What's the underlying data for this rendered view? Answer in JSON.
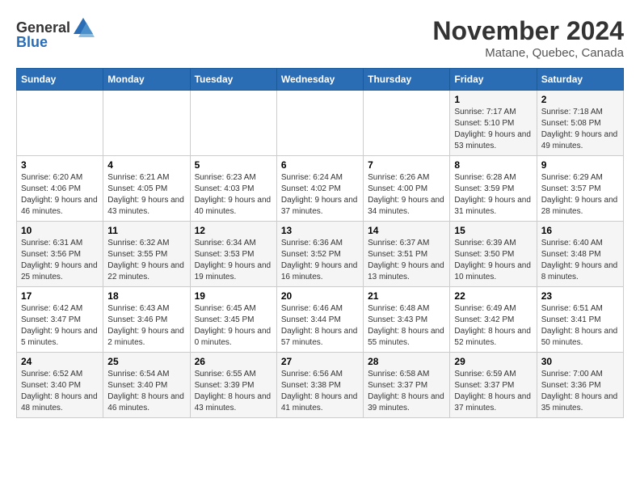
{
  "header": {
    "logo_general": "General",
    "logo_blue": "Blue",
    "month_year": "November 2024",
    "location": "Matane, Quebec, Canada"
  },
  "weekdays": [
    "Sunday",
    "Monday",
    "Tuesday",
    "Wednesday",
    "Thursday",
    "Friday",
    "Saturday"
  ],
  "weeks": [
    [
      {
        "day": "",
        "info": ""
      },
      {
        "day": "",
        "info": ""
      },
      {
        "day": "",
        "info": ""
      },
      {
        "day": "",
        "info": ""
      },
      {
        "day": "",
        "info": ""
      },
      {
        "day": "1",
        "info": "Sunrise: 7:17 AM\nSunset: 5:10 PM\nDaylight: 9 hours and 53 minutes."
      },
      {
        "day": "2",
        "info": "Sunrise: 7:18 AM\nSunset: 5:08 PM\nDaylight: 9 hours and 49 minutes."
      }
    ],
    [
      {
        "day": "3",
        "info": "Sunrise: 6:20 AM\nSunset: 4:06 PM\nDaylight: 9 hours and 46 minutes."
      },
      {
        "day": "4",
        "info": "Sunrise: 6:21 AM\nSunset: 4:05 PM\nDaylight: 9 hours and 43 minutes."
      },
      {
        "day": "5",
        "info": "Sunrise: 6:23 AM\nSunset: 4:03 PM\nDaylight: 9 hours and 40 minutes."
      },
      {
        "day": "6",
        "info": "Sunrise: 6:24 AM\nSunset: 4:02 PM\nDaylight: 9 hours and 37 minutes."
      },
      {
        "day": "7",
        "info": "Sunrise: 6:26 AM\nSunset: 4:00 PM\nDaylight: 9 hours and 34 minutes."
      },
      {
        "day": "8",
        "info": "Sunrise: 6:28 AM\nSunset: 3:59 PM\nDaylight: 9 hours and 31 minutes."
      },
      {
        "day": "9",
        "info": "Sunrise: 6:29 AM\nSunset: 3:57 PM\nDaylight: 9 hours and 28 minutes."
      }
    ],
    [
      {
        "day": "10",
        "info": "Sunrise: 6:31 AM\nSunset: 3:56 PM\nDaylight: 9 hours and 25 minutes."
      },
      {
        "day": "11",
        "info": "Sunrise: 6:32 AM\nSunset: 3:55 PM\nDaylight: 9 hours and 22 minutes."
      },
      {
        "day": "12",
        "info": "Sunrise: 6:34 AM\nSunset: 3:53 PM\nDaylight: 9 hours and 19 minutes."
      },
      {
        "day": "13",
        "info": "Sunrise: 6:36 AM\nSunset: 3:52 PM\nDaylight: 9 hours and 16 minutes."
      },
      {
        "day": "14",
        "info": "Sunrise: 6:37 AM\nSunset: 3:51 PM\nDaylight: 9 hours and 13 minutes."
      },
      {
        "day": "15",
        "info": "Sunrise: 6:39 AM\nSunset: 3:50 PM\nDaylight: 9 hours and 10 minutes."
      },
      {
        "day": "16",
        "info": "Sunrise: 6:40 AM\nSunset: 3:48 PM\nDaylight: 9 hours and 8 minutes."
      }
    ],
    [
      {
        "day": "17",
        "info": "Sunrise: 6:42 AM\nSunset: 3:47 PM\nDaylight: 9 hours and 5 minutes."
      },
      {
        "day": "18",
        "info": "Sunrise: 6:43 AM\nSunset: 3:46 PM\nDaylight: 9 hours and 2 minutes."
      },
      {
        "day": "19",
        "info": "Sunrise: 6:45 AM\nSunset: 3:45 PM\nDaylight: 9 hours and 0 minutes."
      },
      {
        "day": "20",
        "info": "Sunrise: 6:46 AM\nSunset: 3:44 PM\nDaylight: 8 hours and 57 minutes."
      },
      {
        "day": "21",
        "info": "Sunrise: 6:48 AM\nSunset: 3:43 PM\nDaylight: 8 hours and 55 minutes."
      },
      {
        "day": "22",
        "info": "Sunrise: 6:49 AM\nSunset: 3:42 PM\nDaylight: 8 hours and 52 minutes."
      },
      {
        "day": "23",
        "info": "Sunrise: 6:51 AM\nSunset: 3:41 PM\nDaylight: 8 hours and 50 minutes."
      }
    ],
    [
      {
        "day": "24",
        "info": "Sunrise: 6:52 AM\nSunset: 3:40 PM\nDaylight: 8 hours and 48 minutes."
      },
      {
        "day": "25",
        "info": "Sunrise: 6:54 AM\nSunset: 3:40 PM\nDaylight: 8 hours and 46 minutes."
      },
      {
        "day": "26",
        "info": "Sunrise: 6:55 AM\nSunset: 3:39 PM\nDaylight: 8 hours and 43 minutes."
      },
      {
        "day": "27",
        "info": "Sunrise: 6:56 AM\nSunset: 3:38 PM\nDaylight: 8 hours and 41 minutes."
      },
      {
        "day": "28",
        "info": "Sunrise: 6:58 AM\nSunset: 3:37 PM\nDaylight: 8 hours and 39 minutes."
      },
      {
        "day": "29",
        "info": "Sunrise: 6:59 AM\nSunset: 3:37 PM\nDaylight: 8 hours and 37 minutes."
      },
      {
        "day": "30",
        "info": "Sunrise: 7:00 AM\nSunset: 3:36 PM\nDaylight: 8 hours and 35 minutes."
      }
    ]
  ]
}
